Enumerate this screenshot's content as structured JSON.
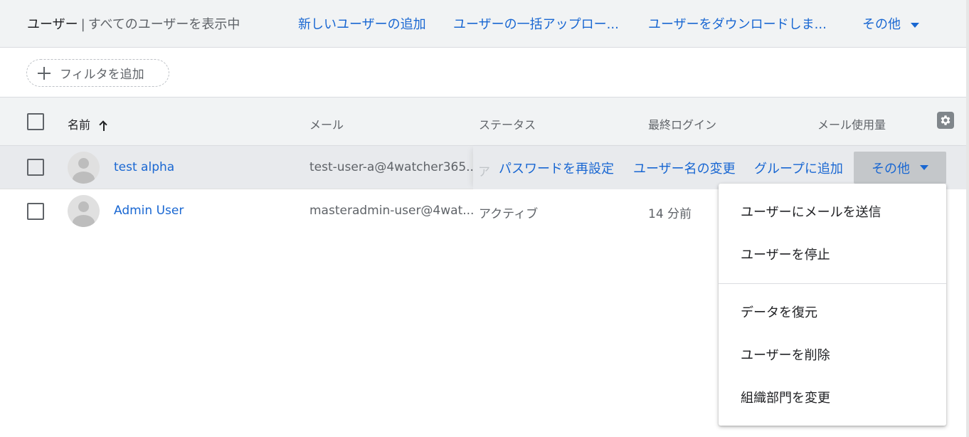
{
  "header": {
    "title": "ユーザー",
    "separator": "|",
    "subtitle": "すべてのユーザーを表示中",
    "links": {
      "add_user": "新しいユーザーの追加",
      "bulk_upload": "ユーザーの一括アップロー...",
      "download": "ユーザーをダウンロードしま...",
      "more": "その他"
    }
  },
  "filter": {
    "add_label": "フィルタを追加"
  },
  "table": {
    "columns": {
      "name": "名前",
      "email": "メール",
      "status": "ステータス",
      "last_login": "最終ログイン",
      "mail_usage": "メール使用量"
    },
    "rows": [
      {
        "name": "test alpha",
        "email": "test-user-a@4watcher365...",
        "status_partial": "ア",
        "actions": {
          "reset_password": "パスワードを再設定",
          "rename": "ユーザー名の変更",
          "add_to_group": "グループに追加",
          "more": "その他"
        }
      },
      {
        "name": "Admin User",
        "email": "masteradmin-user@4wat...",
        "status": "アクティブ",
        "last_login": "14 分前"
      }
    ]
  },
  "more_menu": {
    "items": [
      "ユーザーにメールを送信",
      "ユーザーを停止",
      "データを復元",
      "ユーザーを削除",
      "組織部門を変更"
    ]
  },
  "colors": {
    "link": "#1967d2",
    "header_bg": "#f1f3f4",
    "hover_row_bg": "#e8eaed"
  },
  "icons": {
    "sort": "arrow-up-icon",
    "settings": "gear-icon",
    "filter_add": "plus-icon",
    "dropdown": "caret-down-icon",
    "avatar": "default-avatar-icon"
  }
}
